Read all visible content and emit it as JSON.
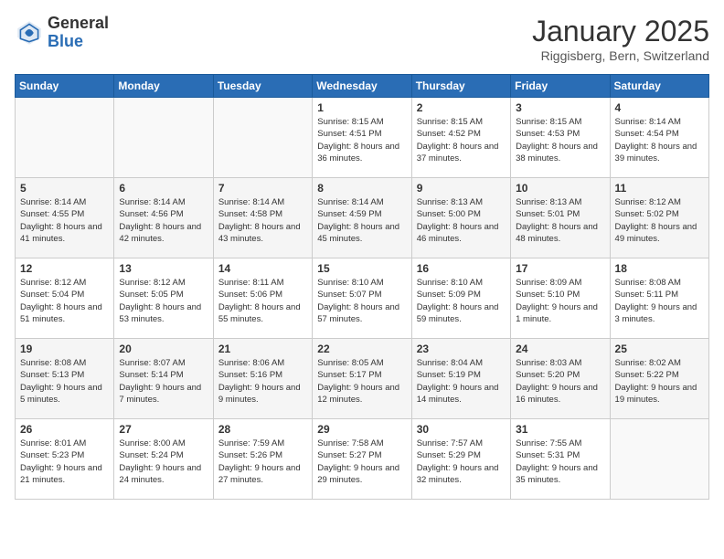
{
  "logo": {
    "general": "General",
    "blue": "Blue"
  },
  "title": "January 2025",
  "subtitle": "Riggisberg, Bern, Switzerland",
  "weekdays": [
    "Sunday",
    "Monday",
    "Tuesday",
    "Wednesday",
    "Thursday",
    "Friday",
    "Saturday"
  ],
  "weeks": [
    [
      {
        "day": "",
        "detail": ""
      },
      {
        "day": "",
        "detail": ""
      },
      {
        "day": "",
        "detail": ""
      },
      {
        "day": "1",
        "detail": "Sunrise: 8:15 AM\nSunset: 4:51 PM\nDaylight: 8 hours and 36 minutes."
      },
      {
        "day": "2",
        "detail": "Sunrise: 8:15 AM\nSunset: 4:52 PM\nDaylight: 8 hours and 37 minutes."
      },
      {
        "day": "3",
        "detail": "Sunrise: 8:15 AM\nSunset: 4:53 PM\nDaylight: 8 hours and 38 minutes."
      },
      {
        "day": "4",
        "detail": "Sunrise: 8:14 AM\nSunset: 4:54 PM\nDaylight: 8 hours and 39 minutes."
      }
    ],
    [
      {
        "day": "5",
        "detail": "Sunrise: 8:14 AM\nSunset: 4:55 PM\nDaylight: 8 hours and 41 minutes."
      },
      {
        "day": "6",
        "detail": "Sunrise: 8:14 AM\nSunset: 4:56 PM\nDaylight: 8 hours and 42 minutes."
      },
      {
        "day": "7",
        "detail": "Sunrise: 8:14 AM\nSunset: 4:58 PM\nDaylight: 8 hours and 43 minutes."
      },
      {
        "day": "8",
        "detail": "Sunrise: 8:14 AM\nSunset: 4:59 PM\nDaylight: 8 hours and 45 minutes."
      },
      {
        "day": "9",
        "detail": "Sunrise: 8:13 AM\nSunset: 5:00 PM\nDaylight: 8 hours and 46 minutes."
      },
      {
        "day": "10",
        "detail": "Sunrise: 8:13 AM\nSunset: 5:01 PM\nDaylight: 8 hours and 48 minutes."
      },
      {
        "day": "11",
        "detail": "Sunrise: 8:12 AM\nSunset: 5:02 PM\nDaylight: 8 hours and 49 minutes."
      }
    ],
    [
      {
        "day": "12",
        "detail": "Sunrise: 8:12 AM\nSunset: 5:04 PM\nDaylight: 8 hours and 51 minutes."
      },
      {
        "day": "13",
        "detail": "Sunrise: 8:12 AM\nSunset: 5:05 PM\nDaylight: 8 hours and 53 minutes."
      },
      {
        "day": "14",
        "detail": "Sunrise: 8:11 AM\nSunset: 5:06 PM\nDaylight: 8 hours and 55 minutes."
      },
      {
        "day": "15",
        "detail": "Sunrise: 8:10 AM\nSunset: 5:07 PM\nDaylight: 8 hours and 57 minutes."
      },
      {
        "day": "16",
        "detail": "Sunrise: 8:10 AM\nSunset: 5:09 PM\nDaylight: 8 hours and 59 minutes."
      },
      {
        "day": "17",
        "detail": "Sunrise: 8:09 AM\nSunset: 5:10 PM\nDaylight: 9 hours and 1 minute."
      },
      {
        "day": "18",
        "detail": "Sunrise: 8:08 AM\nSunset: 5:11 PM\nDaylight: 9 hours and 3 minutes."
      }
    ],
    [
      {
        "day": "19",
        "detail": "Sunrise: 8:08 AM\nSunset: 5:13 PM\nDaylight: 9 hours and 5 minutes."
      },
      {
        "day": "20",
        "detail": "Sunrise: 8:07 AM\nSunset: 5:14 PM\nDaylight: 9 hours and 7 minutes."
      },
      {
        "day": "21",
        "detail": "Sunrise: 8:06 AM\nSunset: 5:16 PM\nDaylight: 9 hours and 9 minutes."
      },
      {
        "day": "22",
        "detail": "Sunrise: 8:05 AM\nSunset: 5:17 PM\nDaylight: 9 hours and 12 minutes."
      },
      {
        "day": "23",
        "detail": "Sunrise: 8:04 AM\nSunset: 5:19 PM\nDaylight: 9 hours and 14 minutes."
      },
      {
        "day": "24",
        "detail": "Sunrise: 8:03 AM\nSunset: 5:20 PM\nDaylight: 9 hours and 16 minutes."
      },
      {
        "day": "25",
        "detail": "Sunrise: 8:02 AM\nSunset: 5:22 PM\nDaylight: 9 hours and 19 minutes."
      }
    ],
    [
      {
        "day": "26",
        "detail": "Sunrise: 8:01 AM\nSunset: 5:23 PM\nDaylight: 9 hours and 21 minutes."
      },
      {
        "day": "27",
        "detail": "Sunrise: 8:00 AM\nSunset: 5:24 PM\nDaylight: 9 hours and 24 minutes."
      },
      {
        "day": "28",
        "detail": "Sunrise: 7:59 AM\nSunset: 5:26 PM\nDaylight: 9 hours and 27 minutes."
      },
      {
        "day": "29",
        "detail": "Sunrise: 7:58 AM\nSunset: 5:27 PM\nDaylight: 9 hours and 29 minutes."
      },
      {
        "day": "30",
        "detail": "Sunrise: 7:57 AM\nSunset: 5:29 PM\nDaylight: 9 hours and 32 minutes."
      },
      {
        "day": "31",
        "detail": "Sunrise: 7:55 AM\nSunset: 5:31 PM\nDaylight: 9 hours and 35 minutes."
      },
      {
        "day": "",
        "detail": ""
      }
    ]
  ]
}
